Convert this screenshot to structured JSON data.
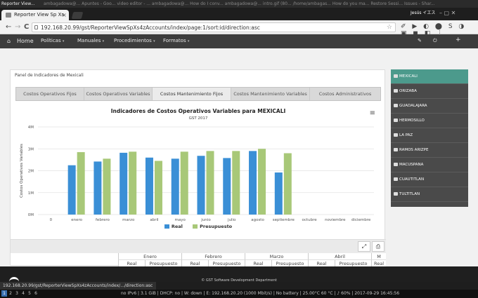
{
  "os_topbar": {
    "title": "Reporter View...",
    "other": "ambagadowa@... Apuntes - Goo... video editor - ... ambagadowa@... How do I conv... ambagadowa@... intro.gif (80... /home/ambagas... How do you ma... Restore Sessi... Issues - Shar..."
  },
  "browser": {
    "tab_title": "Reporter View Sp Xs",
    "tab_close": "×",
    "user": "Jesús イエス",
    "url": "192.168.20.99/gst/ReporterViewSpXs4zAccounts/index/page:1/sort:id/direction:asc",
    "win_buttons": "–  ▢  ✕",
    "back": "←",
    "forward": "→",
    "reload": "C",
    "star": "☆",
    "extensions": "✐ ▶ ◐ ⬤ S ◑ ▣ ◼ ◧ ⋮"
  },
  "appnav": {
    "home": "Home",
    "items": [
      {
        "label": "Políticas",
        "caret": "▾"
      },
      {
        "label": "Manuales",
        "caret": "▾"
      },
      {
        "label": "Procedimientos",
        "caret": "▾"
      },
      {
        "label": "Formatos",
        "caret": "▾"
      }
    ],
    "right_icons": [
      "✎",
      "⏻",
      "+"
    ]
  },
  "panel": {
    "title": "Panel de Indicadores de Mexicali",
    "tabs": [
      "Costos Operativos Fijos",
      "Costos Operativos Variables",
      "Costos Mantenimiento Fijos",
      "Costos Mantenimiento Variables",
      "Costos Administrativos"
    ],
    "active_tab": 2
  },
  "chart_data": {
    "type": "bar",
    "title": "Indicadores de Costos Operativos Variables para MEXICALI",
    "subtitle": "GST 2017",
    "ylabel": "Costos Operativos Variables",
    "xlabel": "",
    "categories": [
      "0",
      "enero",
      "febrero",
      "marzo",
      "abril",
      "mayo",
      "junio",
      "julio",
      "agosto",
      "septiembre",
      "octubre",
      "noviembre",
      "diciembre"
    ],
    "series": [
      {
        "name": "Real",
        "color": "#3a8fd6",
        "values": [
          null,
          2.25,
          2.42,
          2.82,
          2.6,
          2.55,
          2.68,
          2.58,
          2.9,
          1.92,
          null,
          null,
          null
        ]
      },
      {
        "name": "Presupuesto",
        "color": "#a8c878",
        "values": [
          null,
          2.85,
          2.55,
          2.87,
          2.45,
          2.87,
          2.9,
          2.9,
          3.0,
          2.8,
          null,
          null,
          null
        ]
      }
    ],
    "yticks": [
      "0M",
      "1M",
      "2M",
      "3M",
      "4M"
    ],
    "ylim": [
      0,
      4
    ],
    "grid": true,
    "legend": "bottom"
  },
  "chart_menu_icon": "≡",
  "table_tools": {
    "expand": "⤢",
    "print": "⎙"
  },
  "table": {
    "months": [
      "Enero",
      "Febrero",
      "Marzo",
      "Abril",
      "M"
    ],
    "subheaders": [
      "Real",
      "Presupuesto"
    ]
  },
  "sidebar": {
    "items": [
      "MEXICALI",
      "ORIZABA",
      "GUADALAJARA",
      "HERMOSILLO",
      "LA PAZ",
      "RAMOS ARIZPE",
      "MACUSPANA",
      "CUAUTITLAN",
      "TULTITLAN"
    ],
    "active": 0
  },
  "footer": {
    "text": "© GST Software Development Department"
  },
  "status_url": "192.168.20.99/gst/ReporterViewSpXs4zAccounts/index/.../direction:asc",
  "bottombar": {
    "workspaces": [
      "1",
      "2",
      "3",
      "4",
      "5",
      "6"
    ],
    "status": "no IPv6 | 3.1 GiB | DHCP: no | W: down | E: 192.168.20.20 (1000 Mbit/s) | No battery | 25.00°C 60 °C | ♪ 60% | 2017-09-29 16:45:56"
  }
}
